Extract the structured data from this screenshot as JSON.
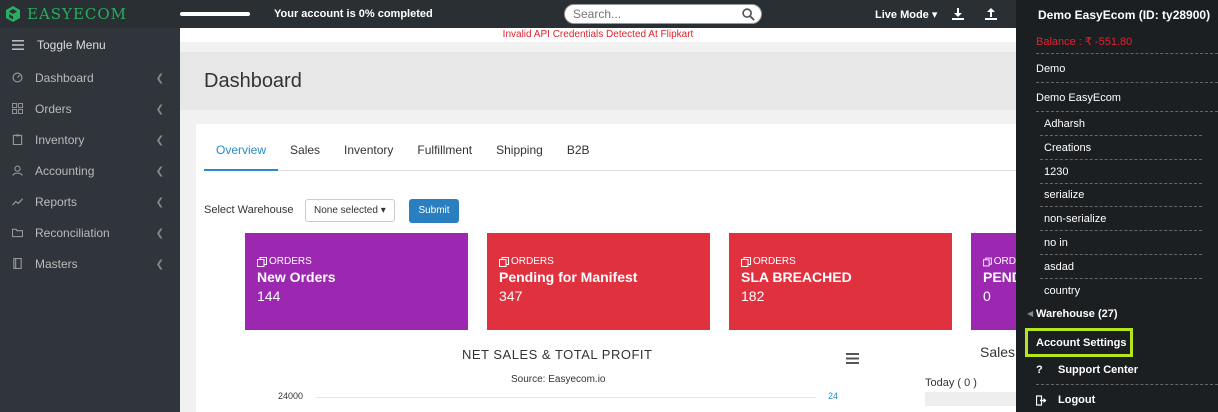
{
  "brand": {
    "name": "EASYECOM"
  },
  "topbar": {
    "progress_percent": 0,
    "account_status": "Your account is 0% completed",
    "search_placeholder": "Search...",
    "live_mode": "Live Mode ▾",
    "user_label": "Demo EasyEcom (ID: ty28900)"
  },
  "sidebar": {
    "toggle_label": "Toggle Menu",
    "items": [
      {
        "label": "Dashboard",
        "icon": "dashboard-icon"
      },
      {
        "label": "Orders",
        "icon": "grid-icon"
      },
      {
        "label": "Inventory",
        "icon": "clipboard-icon"
      },
      {
        "label": "Accounting",
        "icon": "users-icon"
      },
      {
        "label": "Reports",
        "icon": "line-chart-icon"
      },
      {
        "label": "Reconciliation",
        "icon": "folder-icon"
      },
      {
        "label": "Masters",
        "icon": "book-icon"
      }
    ]
  },
  "notice": "Invalid API Credentials Detected At Flipkart",
  "page_title": "Dashboard",
  "tabs": [
    "Overview",
    "Sales",
    "Inventory",
    "Fulfillment",
    "Shipping",
    "B2B"
  ],
  "warehouse": {
    "label": "Select Warehouse",
    "selected": "None selected ▾",
    "submit": "Submit"
  },
  "cards": [
    {
      "caption": "ORDERS",
      "title": "New Orders",
      "value": "144",
      "color": "#9c27b0"
    },
    {
      "caption": "ORDERS",
      "title": "Pending for Manifest",
      "value": "347",
      "color": "#e0313f"
    },
    {
      "caption": "ORDERS",
      "title": "SLA BREACHED",
      "value": "182",
      "color": "#e0313f"
    },
    {
      "caption": "ORD",
      "title": "PEND",
      "value": "0",
      "color": "#9c27b0"
    }
  ],
  "chart": {
    "title": "NET SALES & TOTAL PROFIT",
    "subtitle": "Source: Easyecom.io",
    "y_left_top": "24000",
    "y_right_top": "24"
  },
  "sales_panel": {
    "title": "Sales",
    "today": "Today ( 0 )"
  },
  "dropdown": {
    "balance": "Balance : ₹ -551.80",
    "demo": "Demo",
    "demo_easyecom": "Demo EasyEcom",
    "companies": [
      "Adharsh",
      "Creations",
      "1230",
      "serialize",
      "non-serialize",
      "no in",
      "asdad",
      "country"
    ],
    "warehouse": "Warehouse (27)",
    "account_settings": "Account Settings",
    "support_center": "Support Center",
    "logout": "Logout"
  }
}
